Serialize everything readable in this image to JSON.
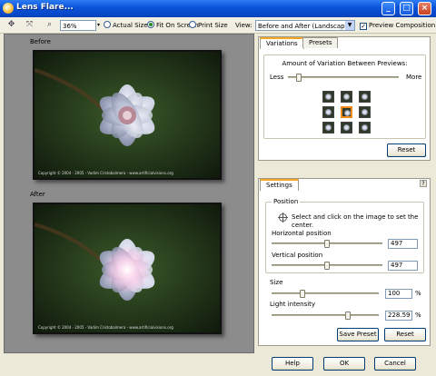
{
  "window": {
    "title": "Lens Flare..."
  },
  "toolbar": {
    "zoom_value": "36%",
    "actual_size_label": "Actual Size",
    "fit_on_screen_label": "Fit On Screen",
    "print_size_label": "Print Size",
    "view_label": "View:",
    "view_value": "Before and After (Landscape)",
    "preview_composition_label": "Preview Composition",
    "selected_size_mode": "fit_on_screen"
  },
  "preview": {
    "before_label": "Before",
    "after_label": "After",
    "copyright": "Copyright © 2004 - 2005 - Vadim Cristobalmera - www.artificialvisions.org"
  },
  "variations_panel": {
    "tabs": [
      "Variations",
      "Presets"
    ],
    "active_tab": "Variations",
    "amount_label": "Amount of Variation Between Previews:",
    "less_label": "Less",
    "more_label": "More",
    "amount_fraction": 0.08,
    "grid_selected_index": 4,
    "reset_label": "Reset"
  },
  "settings_panel": {
    "tab": "Settings",
    "help": "?",
    "position_legend": "Position",
    "position_hint": "Select and click on the image to set the center.",
    "horizontal_label": "Horizontal position",
    "horizontal_value": "497",
    "horizontal_fraction": 0.5,
    "vertical_label": "Vertical position",
    "vertical_value": "497",
    "vertical_fraction": 0.5,
    "size_label": "Size",
    "size_value": "100",
    "size_fraction": 0.28,
    "size_unit": "%",
    "intensity_label": "Light intensity",
    "intensity_value": "228.59",
    "intensity_fraction": 0.72,
    "intensity_unit": "%",
    "save_preset_label": "Save Preset",
    "reset_label": "Reset"
  },
  "footer": {
    "help_label": "Help",
    "ok_label": "OK",
    "cancel_label": "Cancel"
  },
  "colors": {
    "titlebar": "#0a52d8",
    "accent_tab": "#f5a623",
    "selection": "#f28a1a"
  }
}
